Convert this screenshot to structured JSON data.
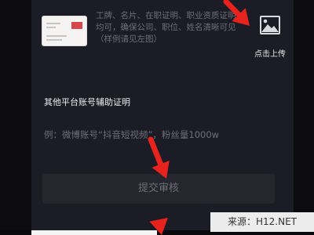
{
  "colors": {
    "arrow": "#e8231d",
    "panel_bg": "#1c1c26",
    "muted_text": "#6e6e7a",
    "button_bg": "#26262f"
  },
  "upload": {
    "hint_text": "工牌、名片、在职证明、职业资质证明均可，确保公司、职位、姓名清晰可见（样例请见左图）",
    "icon": "image-icon",
    "label": "点击上传"
  },
  "aux_proof": {
    "title": "其他平台账号辅助证明",
    "example": "例：微博账号“抖音短视频”，粉丝量1000w"
  },
  "submit": {
    "label": "提交审核"
  },
  "watermark": {
    "text": "来源：H12.NET"
  }
}
